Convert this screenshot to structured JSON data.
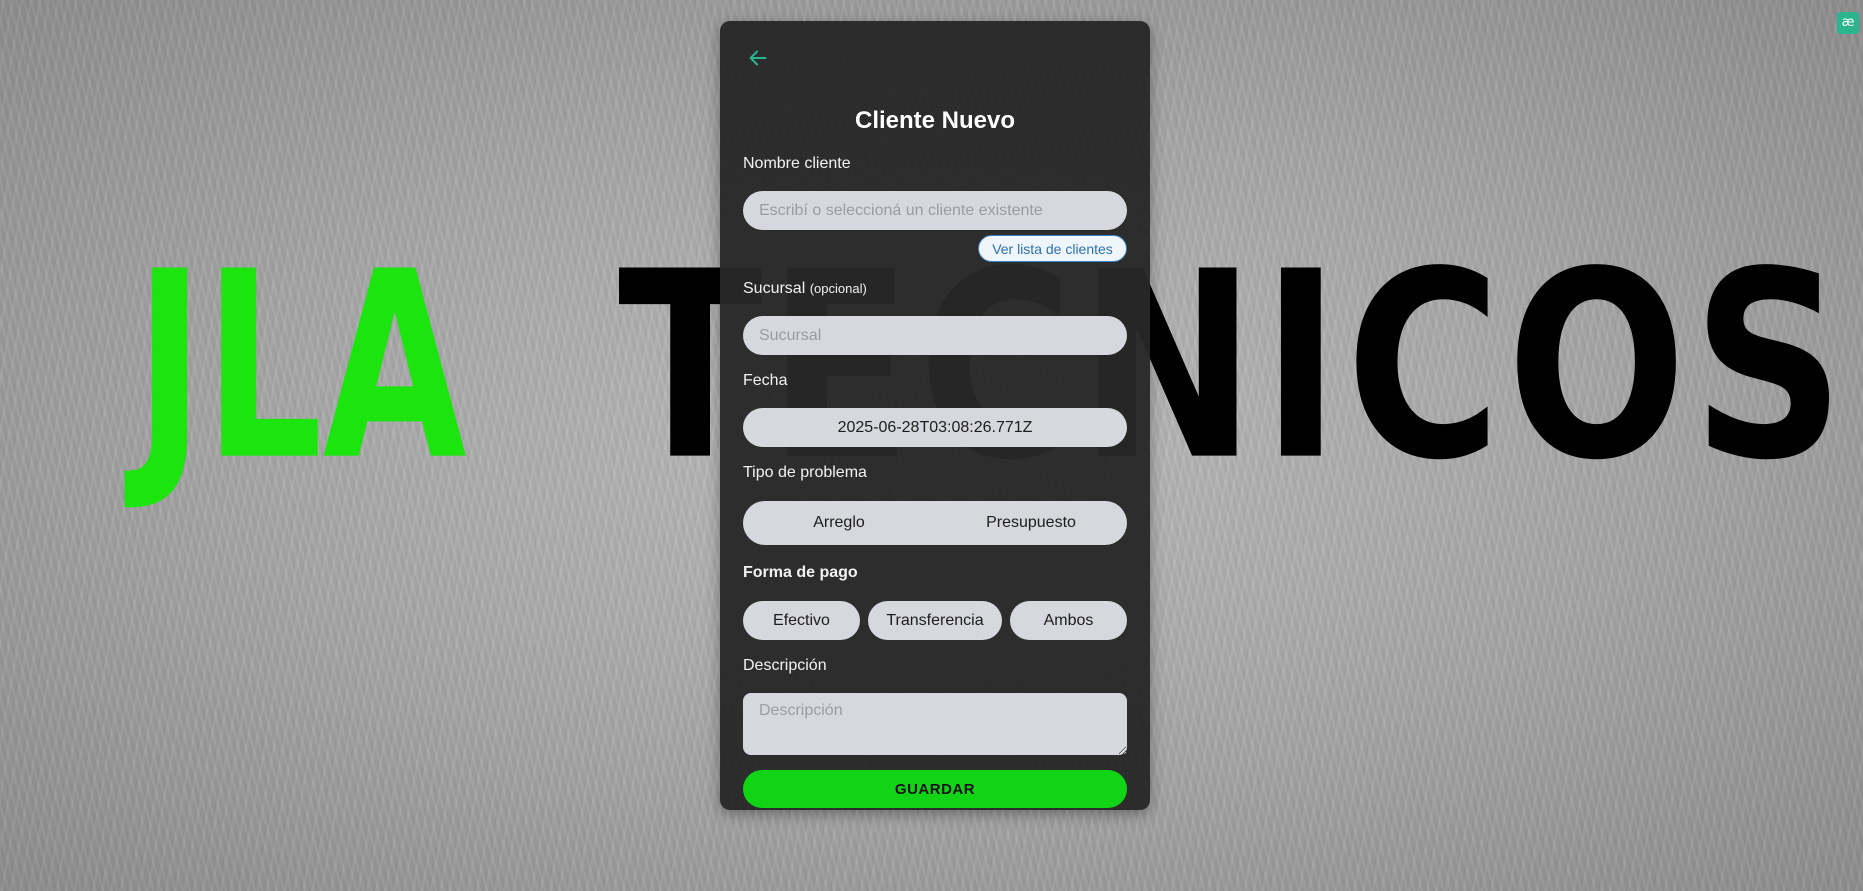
{
  "background": {
    "brand_primary": "JLA",
    "brand_secondary": "TECNICOS",
    "brand_primary_color": "#1be40f",
    "brand_secondary_color": "#000000"
  },
  "corner_badge": {
    "icon": "translate-icon",
    "glyph": "æ"
  },
  "form": {
    "back_icon": "arrow-left-icon",
    "accent_color": "#2bb58e",
    "title": "Cliente Nuevo",
    "client_name": {
      "label": "Nombre cliente",
      "value": "",
      "placeholder": "Escribí o seleccioná un cliente existente",
      "list_button": "Ver lista de clientes"
    },
    "branch": {
      "label": "Sucursal",
      "label_hint": "(opcional)",
      "value": "",
      "placeholder": "Sucursal"
    },
    "date": {
      "label": "Fecha",
      "value": "2025-06-28T03:08:26.771Z"
    },
    "problem_type": {
      "label": "Tipo de problema",
      "options": [
        "Arreglo",
        "Presupuesto"
      ]
    },
    "payment": {
      "label": "Forma de pago",
      "options": [
        "Efectivo",
        "Transferencia",
        "Ambos"
      ]
    },
    "description": {
      "label": "Descripción",
      "value": "",
      "placeholder": "Descripción"
    },
    "save_label": "GUARDAR",
    "save_color": "#12d416"
  }
}
